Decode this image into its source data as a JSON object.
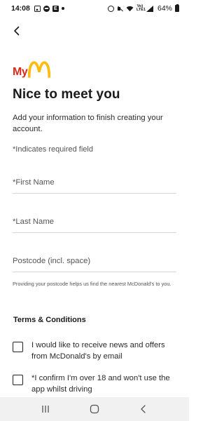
{
  "status_bar": {
    "time": "14:08",
    "e_badge": "E",
    "volte": "Vo) LTE1",
    "battery": "64%"
  },
  "logo": {
    "text": "My"
  },
  "page": {
    "title": "Nice to meet you",
    "intro": "Add your information to finish creating your account.",
    "required_note": "*Indicates required field"
  },
  "form": {
    "first_name_label": "*First Name",
    "last_name_label": "*Last Name",
    "postcode_label": "Postcode (incl. space)",
    "postcode_help": "Providing your postcode helps us find the nearest McDonald's to you."
  },
  "terms": {
    "heading": "Terms & Conditions",
    "news_label": "I would like to receive news and offers from McDonald's by email",
    "confirm_label": "*I confirm I'm over 18 and won't use the app whilst driving"
  },
  "colors": {
    "brand_red": "#da291c",
    "brand_yellow": "#ffbc0d"
  },
  "icons": {
    "back": "chevron-left-icon",
    "nav_recents": "recents-icon",
    "nav_home": "home-icon",
    "nav_back": "nav-back-icon"
  }
}
